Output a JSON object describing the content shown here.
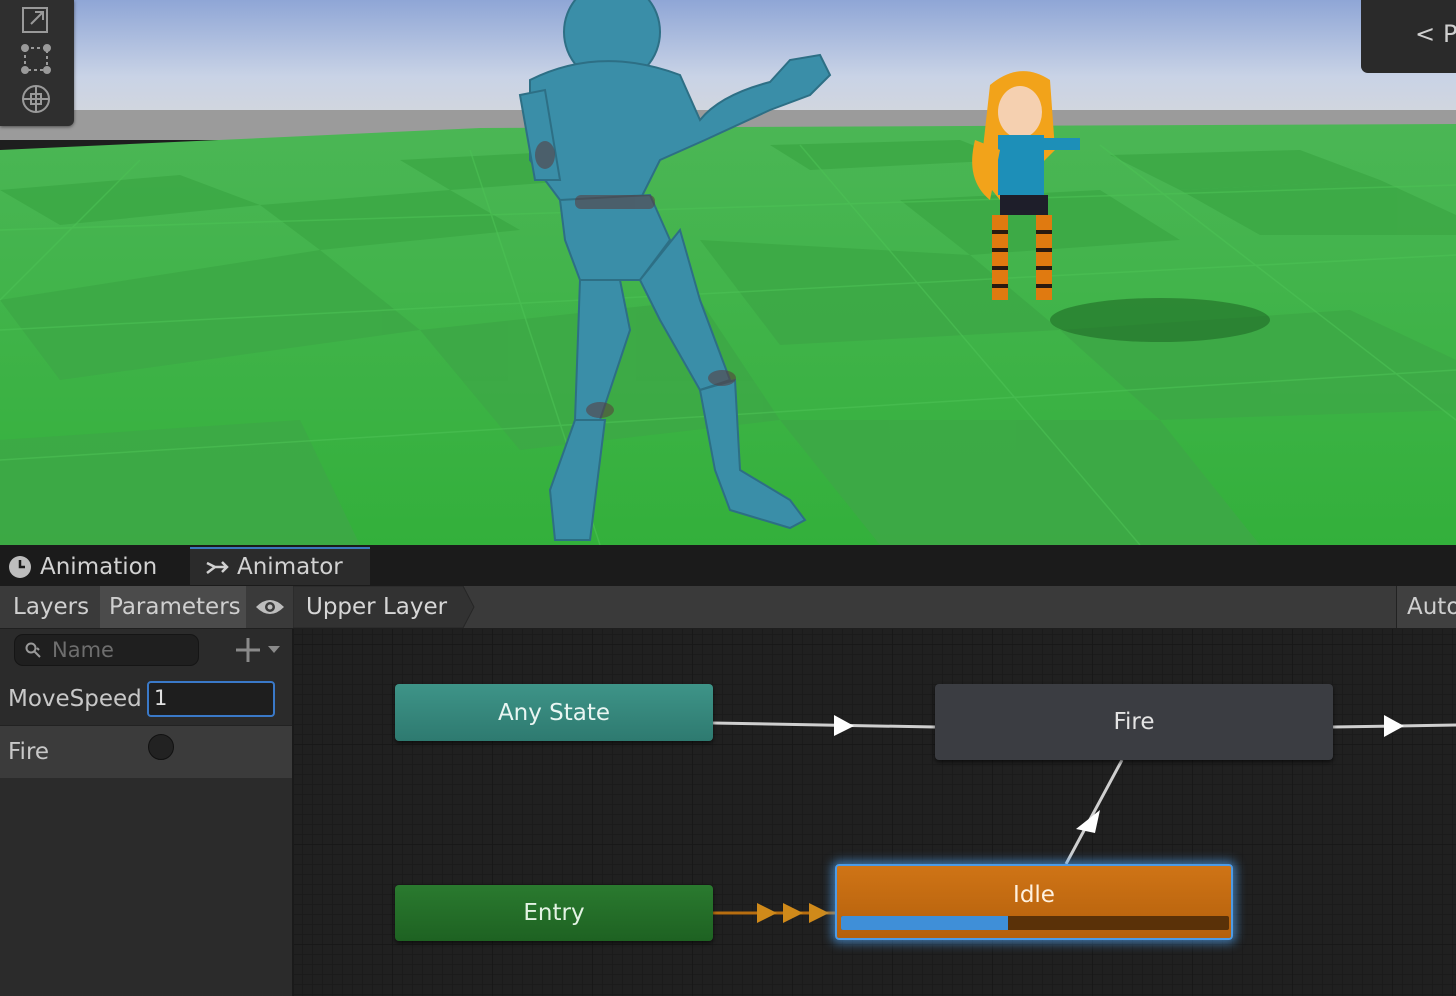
{
  "scene_toolbar": {
    "tools": [
      "rect-transform-icon",
      "rect-tool-icon",
      "transform-icon"
    ]
  },
  "overlay": {
    "label": "P",
    "chevron": "<"
  },
  "tabs": [
    {
      "label": "Animation",
      "icon": "clock-icon"
    },
    {
      "label": "Animator",
      "icon": "animator-icon"
    }
  ],
  "subbar": {
    "layers": "Layers",
    "parameters": "Parameters",
    "layer_name": "Upper Layer",
    "auto_label": "Auto"
  },
  "params": {
    "search_placeholder": "Name",
    "items": [
      {
        "name": "MoveSpeed",
        "type": "float",
        "value": "1"
      },
      {
        "name": "Fire",
        "type": "trigger",
        "value": ""
      }
    ]
  },
  "graph": {
    "nodes": {
      "any_state": "Any State",
      "fire": "Fire",
      "entry": "Entry",
      "idle": "Idle"
    },
    "idle_progress": 0.43
  },
  "colors": {
    "accent": "#3a79bb",
    "idle_orange": "#c96d12",
    "entry_green": "#247029",
    "any_teal": "#3a8d82"
  }
}
